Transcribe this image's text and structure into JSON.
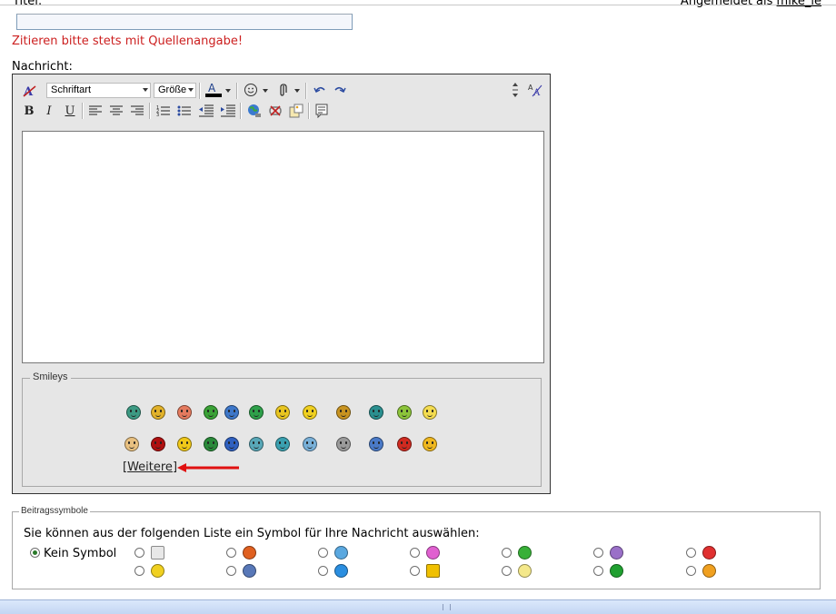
{
  "header": {
    "title_label": "Titel:",
    "title_value": "",
    "login_prefix": "Angemeldet als ",
    "login_user": "mike_le"
  },
  "notice": "Zitieren bitte stets mit Quellenangabe!",
  "message_label": "Nachricht:",
  "editor": {
    "font_select": "Schriftart",
    "size_select": "Größe",
    "text_value": ""
  },
  "smileys": {
    "legend": "Smileys",
    "more_label": "Weitere",
    "arrow_color": "#e01010",
    "row1_colors": [
      "#3c9a83",
      "#e2b22a",
      "#e57a5e",
      "#3aa236",
      "#3d77c9",
      "#2ea04a",
      "#e8c520",
      "#f0d020",
      "#c89320",
      "#2a8f8f",
      "#8cc43a",
      "#f4dc50"
    ],
    "row2_colors": [
      "#e8c080",
      "#b01010",
      "#f0c818",
      "#2a8a3a",
      "#2f60c0",
      "#58a8b8",
      "#3aa0b0",
      "#78b0d8",
      "#9a9a9a",
      "#4a7ac8",
      "#d02a20",
      "#f0b820"
    ]
  },
  "post_symbols": {
    "legend": "Beitragssymbole",
    "description": "Sie können aus der folgenden Liste ein Symbol für Ihre Nachricht auswählen:",
    "none_label": "Kein Symbol",
    "selected": "none",
    "row1_icons": [
      "document-icon",
      "thumbs-down-icon",
      "smile-blue-icon",
      "tongue-pink-icon",
      "grin-green-icon",
      "sad-purple-icon",
      "angry-red-icon"
    ],
    "row1_colors": [
      "#e8e8e8",
      "#e06020",
      "#5aa8e0",
      "#e060d0",
      "#38b038",
      "#9a70c8",
      "#e03030"
    ],
    "row2_icons": [
      "smile-yellow-icon",
      "cool-icon",
      "question-icon",
      "warning-icon",
      "lightbulb-icon",
      "arrow-right-icon",
      "thumbs-up-icon"
    ],
    "row2_colors": [
      "#f0d020",
      "#5878b8",
      "#2a8ee0",
      "#f0c000",
      "#f4e88a",
      "#20a030",
      "#f0a020"
    ]
  }
}
